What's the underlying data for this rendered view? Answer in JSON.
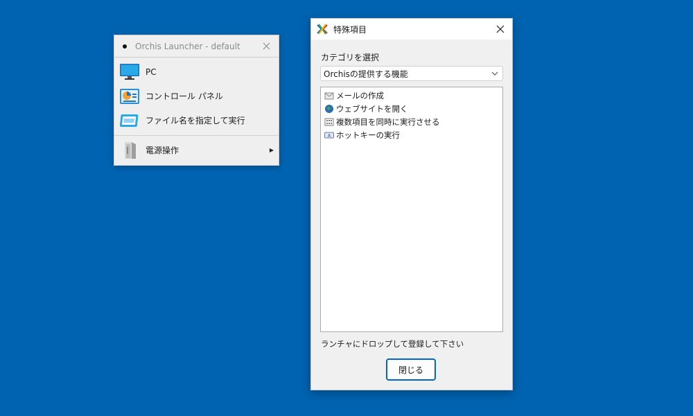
{
  "launcher": {
    "title": "Orchis Launcher - default",
    "items": [
      {
        "label": "PC",
        "icon": "monitor-icon"
      },
      {
        "label": "コントロール パネル",
        "icon": "control-panel-icon"
      },
      {
        "label": "ファイル名を指定して実行",
        "icon": "run-icon"
      }
    ],
    "power": {
      "label": "電源操作",
      "icon": "power-folder-icon"
    }
  },
  "dialog": {
    "title": "特殊項目",
    "category_label": "カテゴリを選択",
    "category_selected": "Orchisの提供する機能",
    "items": [
      {
        "label": "メールの作成",
        "icon": "mail-icon"
      },
      {
        "label": "ウェブサイトを開く",
        "icon": "globe-icon"
      },
      {
        "label": "複数項目を同時に実行させる",
        "icon": "multi-run-icon"
      },
      {
        "label": "ホットキーの実行",
        "icon": "hotkey-icon"
      }
    ],
    "hint": "ランチャにドロップして登録して下さい",
    "close_button": "閉じる"
  },
  "colors": {
    "desktop": "#0063B1",
    "accent": "#0067C0"
  }
}
